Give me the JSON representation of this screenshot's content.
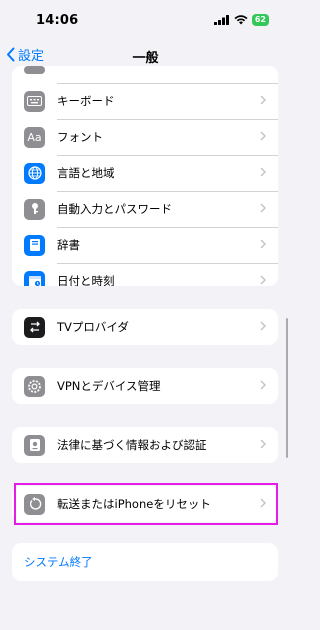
{
  "status_bar": {
    "time": "14:06",
    "battery": "62"
  },
  "nav": {
    "back_label": "設定",
    "title": "一般"
  },
  "list_top": {
    "items": [
      {
        "label": "キーボード",
        "icon": "keyboard-icon",
        "color": "#8e8e93"
      },
      {
        "label": "フォント",
        "icon": "font-icon",
        "color": "#8e8e93"
      },
      {
        "label": "言語と地域",
        "icon": "globe-icon",
        "color": "#007aff"
      },
      {
        "label": "自動入力とパスワード",
        "icon": "autofill-key-icon",
        "color": "#8e8e93"
      },
      {
        "label": "辞書",
        "icon": "dictionary-icon",
        "color": "#007aff"
      },
      {
        "label": "日付と時刻",
        "icon": "calendar-clock-icon",
        "color": "#007aff"
      }
    ]
  },
  "tv_provider": {
    "label": "TVプロバイダ",
    "icon": "tv-provider-icon",
    "color": "#1c1c1e"
  },
  "vpn": {
    "label": "VPNとデバイス管理",
    "icon": "gear-icon",
    "color": "#8e8e93"
  },
  "legal": {
    "label": "法律に基づく情報および認証",
    "icon": "certificate-icon",
    "color": "#8e8e93"
  },
  "reset": {
    "label": "転送またはiPhoneをリセット",
    "icon": "reset-icon",
    "color": "#8e8e93"
  },
  "shutdown": {
    "label": "システム終了"
  },
  "highlight_color": "#e51ce5"
}
